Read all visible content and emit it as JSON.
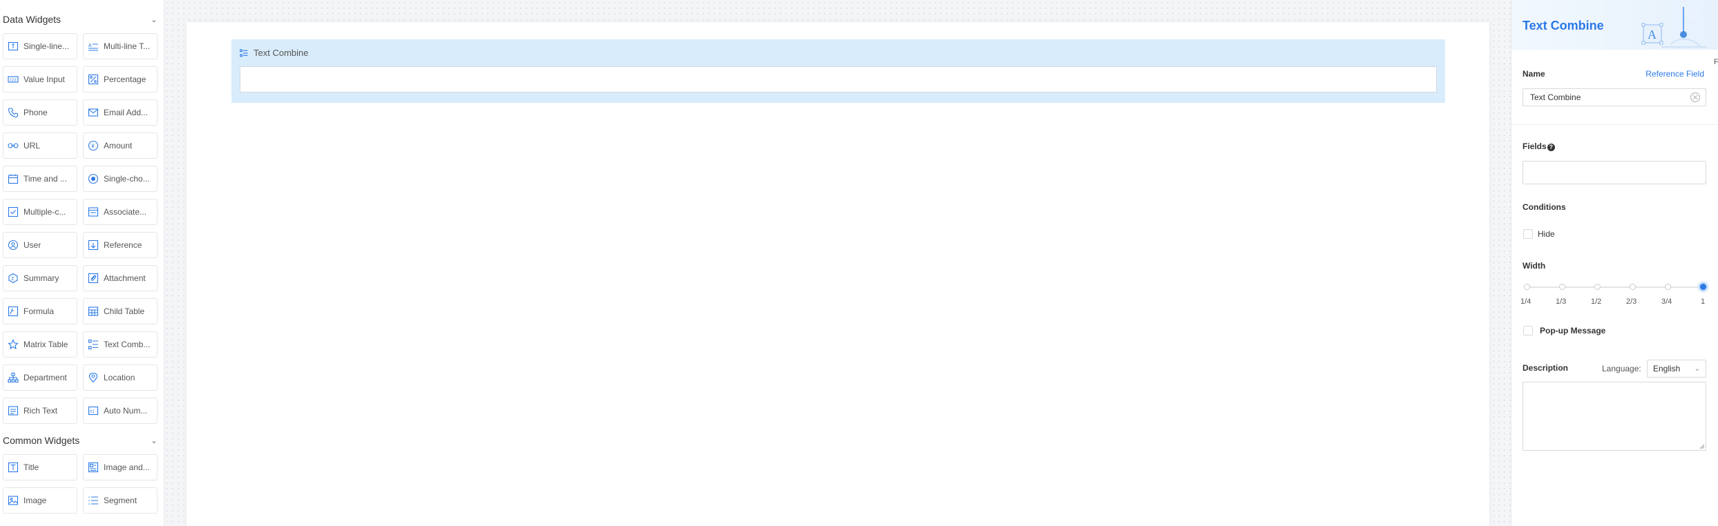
{
  "data_widgets": {
    "title": "Data Widgets",
    "items": [
      {
        "label": "Single-line...",
        "icon": "single-line-text-icon"
      },
      {
        "label": "Multi-line T...",
        "icon": "multi-line-text-icon"
      },
      {
        "label": "Value Input",
        "icon": "value-input-icon"
      },
      {
        "label": "Percentage",
        "icon": "percentage-icon"
      },
      {
        "label": "Phone",
        "icon": "phone-icon"
      },
      {
        "label": "Email Add...",
        "icon": "email-icon"
      },
      {
        "label": "URL",
        "icon": "link-icon"
      },
      {
        "label": "Amount",
        "icon": "amount-icon"
      },
      {
        "label": "Time and ...",
        "icon": "calendar-icon"
      },
      {
        "label": "Single-cho...",
        "icon": "radio-icon"
      },
      {
        "label": "Multiple-c...",
        "icon": "checkbox-icon"
      },
      {
        "label": "Associate...",
        "icon": "associate-icon"
      },
      {
        "label": "User",
        "icon": "user-icon"
      },
      {
        "label": "Reference",
        "icon": "reference-icon"
      },
      {
        "label": "Summary",
        "icon": "summary-icon"
      },
      {
        "label": "Attachment",
        "icon": "attachment-icon"
      },
      {
        "label": "Formula",
        "icon": "formula-icon"
      },
      {
        "label": "Child Table",
        "icon": "child-table-icon"
      },
      {
        "label": "Matrix Table",
        "icon": "matrix-table-icon"
      },
      {
        "label": "Text Comb...",
        "icon": "text-combine-icon"
      },
      {
        "label": "Department",
        "icon": "department-icon"
      },
      {
        "label": "Location",
        "icon": "location-icon"
      },
      {
        "label": "Rich Text",
        "icon": "rich-text-icon"
      },
      {
        "label": "Auto Num...",
        "icon": "auto-number-icon"
      }
    ]
  },
  "common_widgets": {
    "title": "Common Widgets",
    "items": [
      {
        "label": "Title",
        "icon": "title-icon"
      },
      {
        "label": "Image and...",
        "icon": "image-and-text-icon"
      },
      {
        "label": "Image",
        "icon": "image-icon"
      },
      {
        "label": "Segment",
        "icon": "segment-icon"
      }
    ]
  },
  "canvas": {
    "field": {
      "title": "Text Combine",
      "icon": "text-combine-icon",
      "value": ""
    }
  },
  "properties": {
    "title": "Text Combine",
    "name_label": "Name",
    "reference_field_link": "Reference Field",
    "name_value": "Text Combine",
    "fields_label": "Fields",
    "help_icon": "?",
    "conditions_label": "Conditions",
    "hide_label": "Hide",
    "hide_checked": false,
    "width_label": "Width",
    "width_marks": [
      "1/4",
      "1/3",
      "1/2",
      "2/3",
      "3/4",
      "1"
    ],
    "width_selected": "1",
    "popup_label": "Pop-up Message",
    "popup_checked": false,
    "description_label": "Description",
    "language_label": "Language:",
    "language_value": "English",
    "description_value": ""
  },
  "edge_text": "F",
  "colors": {
    "accent": "#2b79e6",
    "field_highlight": "#d9ecfb",
    "canvas_bg": "#f4f5f7"
  }
}
